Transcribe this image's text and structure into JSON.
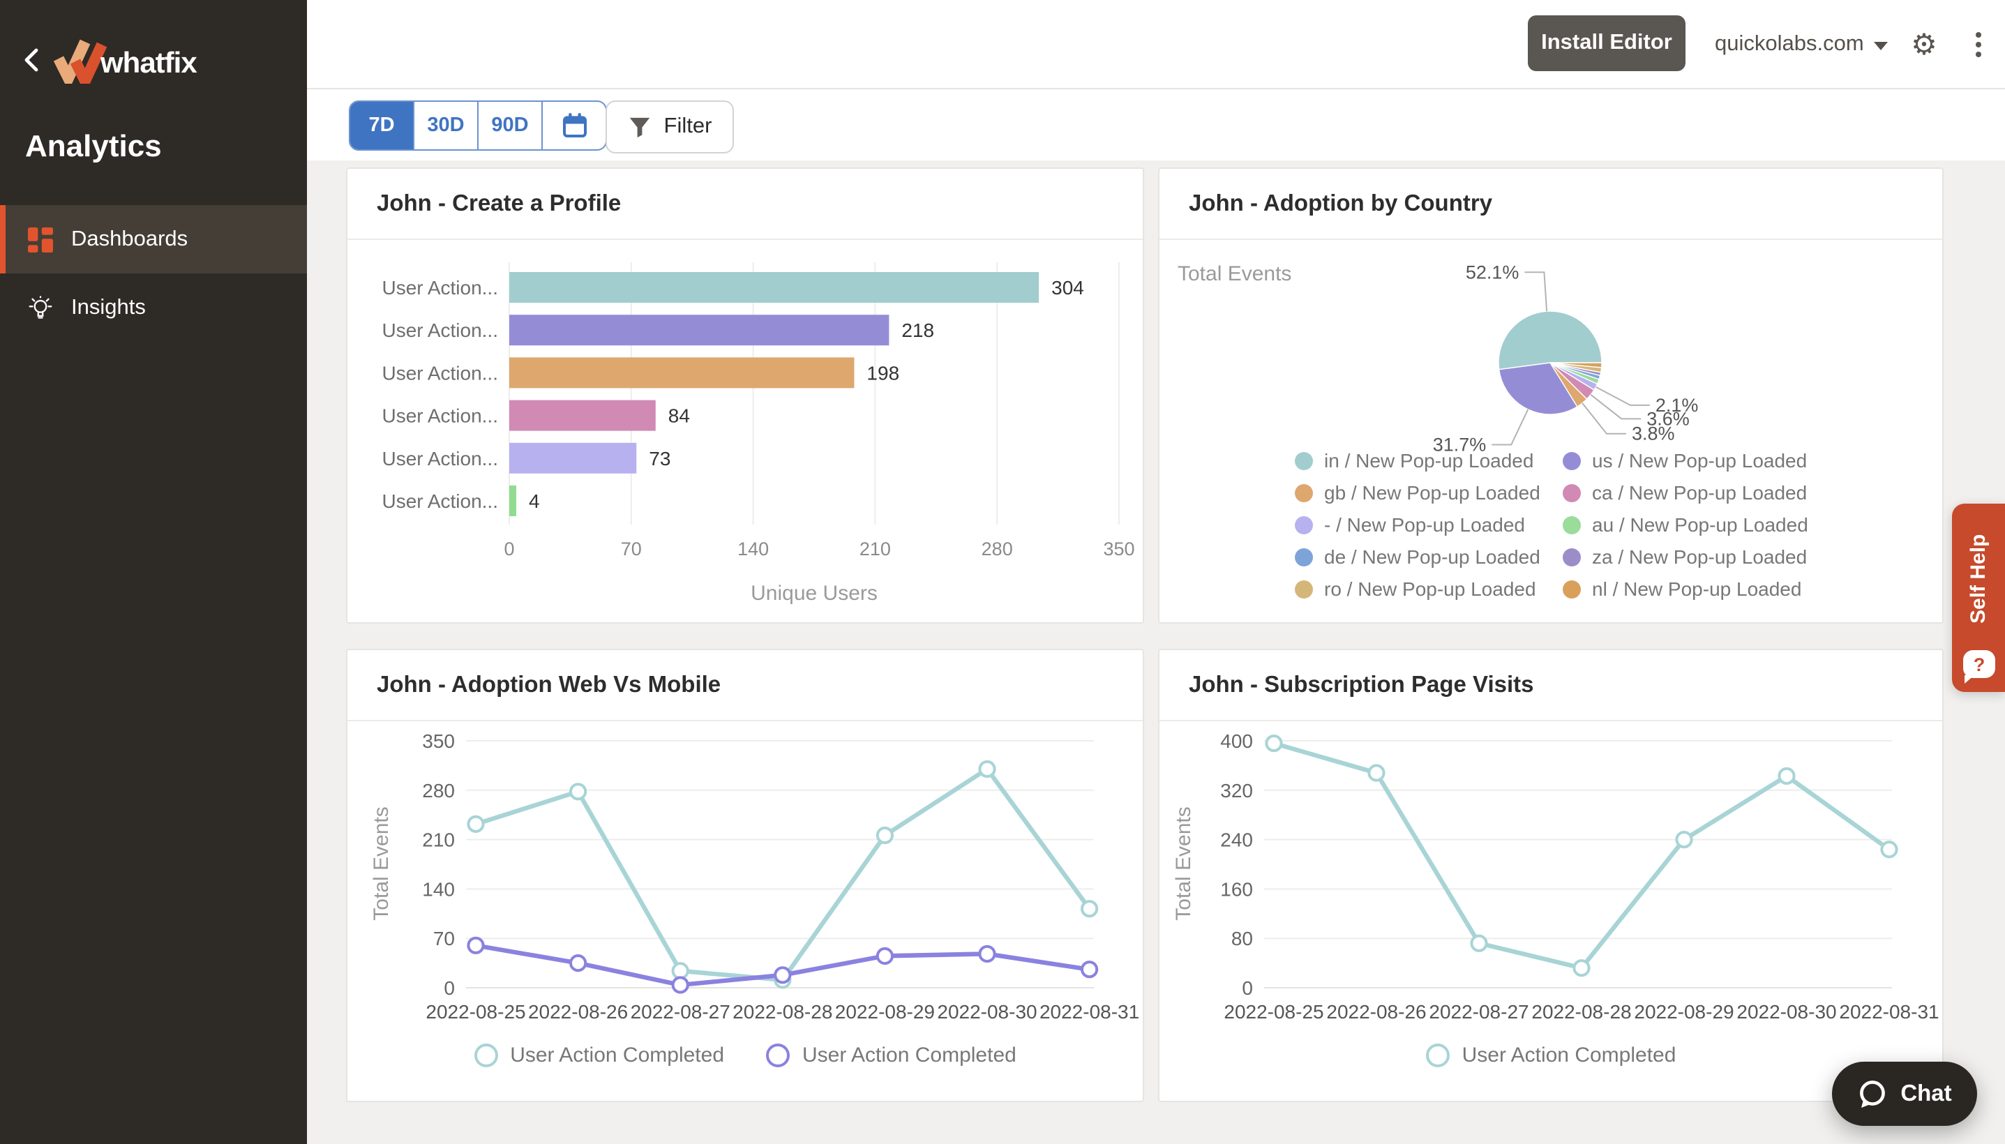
{
  "sidebar": {
    "logo_text": "whatfix",
    "section_title": "Analytics",
    "items": [
      {
        "label": "Dashboards",
        "active": true
      },
      {
        "label": "Insights",
        "active": false
      }
    ]
  },
  "header": {
    "install_button": "Install Editor",
    "account": "quickolabs.com"
  },
  "filters": {
    "ranges": [
      "7D",
      "30D",
      "90D"
    ],
    "active_range": "7D",
    "filter_label": "Filter"
  },
  "self_help": {
    "label": "Self Help",
    "bubble": "?"
  },
  "chat": {
    "label": "Chat"
  },
  "colors": {
    "accent_blue": "#3f74c2",
    "sidebar_bg": "#2e2a26",
    "brand_orange": "#e2542e",
    "self_help_bg": "#c64a2b",
    "chat_bg": "#2a2723"
  },
  "chart_data": [
    {
      "type": "bar",
      "title": "John - Create a Profile",
      "orientation": "horizontal",
      "categories": [
        "User Action...",
        "User Action...",
        "User Action...",
        "User Action...",
        "User Action...",
        "User Action..."
      ],
      "values": [
        304,
        218,
        198,
        84,
        73,
        4
      ],
      "bar_colors": [
        "#a2cdce",
        "#948dd6",
        "#dda76e",
        "#d08ab4",
        "#b7b1f0",
        "#90dc90"
      ],
      "xlabel": "Unique Users",
      "xticks": [
        0,
        70,
        140,
        210,
        280,
        350
      ],
      "xlim": [
        0,
        350
      ],
      "grid": true
    },
    {
      "type": "pie",
      "title": "John - Adoption by Country",
      "note_label": "Total Events",
      "legend_position": "bottom",
      "slices": [
        {
          "name": "in / New Pop-up Loaded",
          "pct": 52.1,
          "color": "#a2cdce",
          "labeled": true
        },
        {
          "name": "us / New Pop-up Loaded",
          "pct": 31.7,
          "color": "#948dd6",
          "labeled": true
        },
        {
          "name": "gb / New Pop-up Loaded",
          "pct": 3.8,
          "color": "#dda76e",
          "labeled": true
        },
        {
          "name": "ca / New Pop-up Loaded",
          "pct": 3.6,
          "color": "#d08ab4",
          "labeled": true
        },
        {
          "name": "- / New Pop-up Loaded",
          "pct": 2.1,
          "color": "#b7b1f0",
          "labeled": true
        },
        {
          "name": "au / New Pop-up Loaded",
          "pct": 1.5,
          "color": "#9adc9a",
          "labeled": false
        },
        {
          "name": "de / New Pop-up Loaded",
          "pct": 1.2,
          "color": "#7ea3d9",
          "labeled": false
        },
        {
          "name": "za / New Pop-up Loaded",
          "pct": 1.0,
          "color": "#9c8dc9",
          "labeled": false
        },
        {
          "name": "ro / New Pop-up Loaded",
          "pct": 1.5,
          "color": "#d4b678",
          "labeled": false
        },
        {
          "name": "nl / New Pop-up Loaded",
          "pct": 1.5,
          "color": "#d9a05b",
          "labeled": false
        }
      ]
    },
    {
      "type": "line",
      "title": "John - Adoption Web Vs Mobile",
      "x": [
        "2022-08-25",
        "2022-08-26",
        "2022-08-27",
        "2022-08-28",
        "2022-08-29",
        "2022-08-30",
        "2022-08-31"
      ],
      "series": [
        {
          "name": "User Action Completed",
          "color": "#a8d4d6",
          "values": [
            232,
            278,
            24,
            11,
            216,
            310,
            112
          ]
        },
        {
          "name": "User Action Completed",
          "color": "#8a82e0",
          "values": [
            60,
            35,
            4,
            18,
            45,
            48,
            26
          ]
        }
      ],
      "ylabel": "Total Events",
      "yticks": [
        0,
        70,
        140,
        210,
        280,
        350
      ],
      "ylim": [
        0,
        350
      ],
      "grid": true,
      "legend_position": "bottom"
    },
    {
      "type": "line",
      "title": "John - Subscription Page Visits",
      "x": [
        "2022-08-25",
        "2022-08-26",
        "2022-08-27",
        "2022-08-28",
        "2022-08-29",
        "2022-08-30",
        "2022-08-31"
      ],
      "series": [
        {
          "name": "User Action Completed",
          "color": "#a8d4d6",
          "values": [
            396,
            348,
            72,
            32,
            240,
            343,
            224
          ]
        }
      ],
      "ylabel": "Total Events",
      "yticks": [
        0,
        80,
        160,
        240,
        320,
        400
      ],
      "ylim": [
        0,
        400
      ],
      "grid": true,
      "legend_position": "bottom"
    }
  ]
}
